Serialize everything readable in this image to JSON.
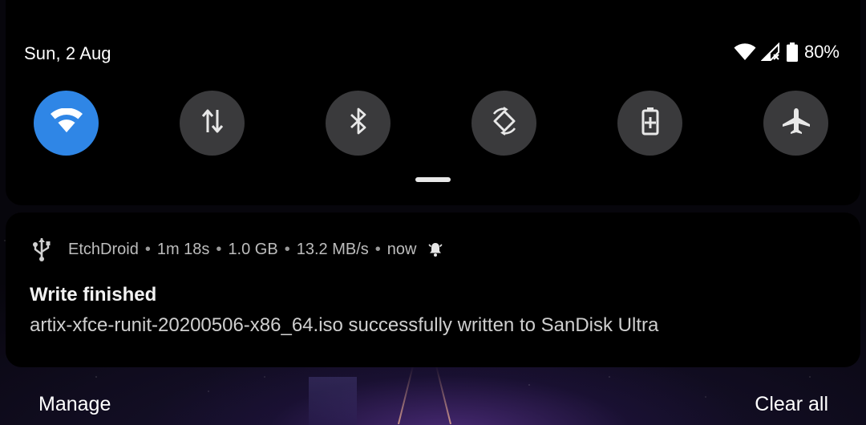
{
  "status_bar": {
    "date": "Sun, 2 Aug",
    "battery_percent": "80%",
    "icons": [
      "wifi-icon",
      "signal-no-service-icon",
      "battery-icon"
    ]
  },
  "quick_settings": {
    "accent_color": "#2f86e6",
    "tiles": [
      {
        "name": "wifi",
        "icon": "wifi-icon",
        "active": true
      },
      {
        "name": "mobile-data",
        "icon": "data-arrows-icon",
        "active": false
      },
      {
        "name": "bluetooth",
        "icon": "bluetooth-icon",
        "active": false
      },
      {
        "name": "auto-rotate",
        "icon": "rotate-icon",
        "active": false
      },
      {
        "name": "battery-saver",
        "icon": "battery-saver-icon",
        "active": false
      },
      {
        "name": "airplane-mode",
        "icon": "airplane-icon",
        "active": false
      }
    ]
  },
  "notification": {
    "app_name": "EtchDroid",
    "elapsed": "1m 18s",
    "size": "1.0 GB",
    "speed": "13.2 MB/s",
    "time": "now",
    "title": "Write finished",
    "text": "artix-xfce-runit-20200506-x86_64.iso successfully written to SanDisk Ultra"
  },
  "actions": {
    "manage": "Manage",
    "clear_all": "Clear all"
  }
}
